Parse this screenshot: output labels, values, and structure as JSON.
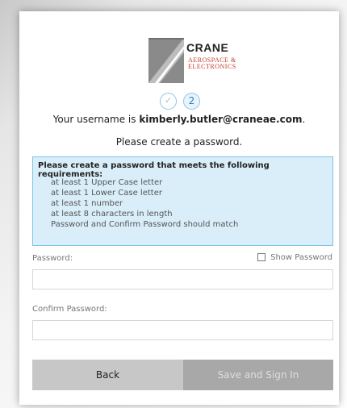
{
  "logo": {
    "brand": "CRANE",
    "subtitle_line1": "AEROSPACE &",
    "subtitle_line2": "ELECTRONICS"
  },
  "steps": [
    {
      "label": "✓",
      "status": "completed"
    },
    {
      "label": "2",
      "status": "current"
    }
  ],
  "header": {
    "username_prefix": "Your username is ",
    "username": "kimberly.butler@craneae.com",
    "username_suffix": ".",
    "instruction": "Please create a password."
  },
  "requirements": {
    "title": "Please create a password that meets the following requirements:",
    "items": [
      "at least 1 Upper Case letter",
      "at least 1 Lower Case letter",
      "at least 1 number",
      "at least 8 characters in length",
      "Password and Confirm Password should match"
    ]
  },
  "form": {
    "password_label": "Password:",
    "password_value": "",
    "show_password_label": "Show Password",
    "show_password_checked": false,
    "confirm_label": "Confirm Password:",
    "confirm_value": ""
  },
  "buttons": {
    "back_label": "Back",
    "save_label": "Save and Sign In"
  },
  "colors": {
    "brand_red": "#c03a2b",
    "info_bg": "#d9eef9",
    "info_border": "#7cc4ea",
    "step_border": "#8ec5e6",
    "button_back": "#c7c7c7",
    "button_save_disabled": "#a8a8a8"
  }
}
